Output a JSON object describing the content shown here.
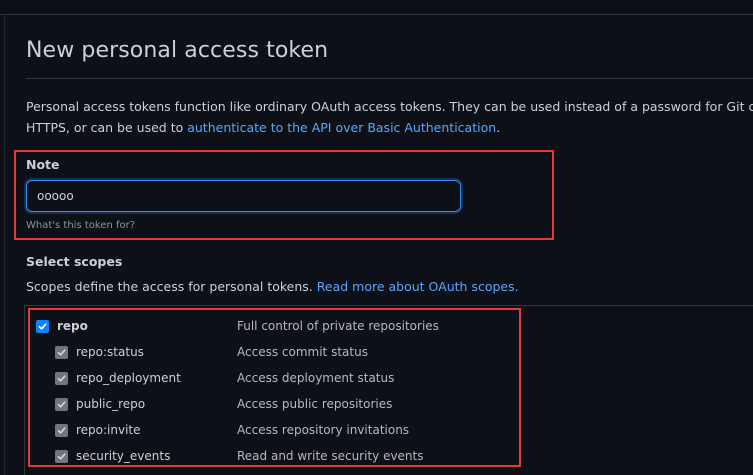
{
  "page": {
    "title": "New personal access token",
    "description_line1": "Personal access tokens function like ordinary OAuth access tokens. They can be used instead of a password for Git over",
    "description_line2_pre": "HTTPS, or can be used to ",
    "description_link": "authenticate to the API over Basic Authentication",
    "description_line2_post": "."
  },
  "note": {
    "label": "Note",
    "value": "ooooo",
    "hint": "What's this token for?"
  },
  "scopes": {
    "heading": "Select scopes",
    "description_pre": "Scopes define the access for personal tokens. ",
    "description_link": "Read more about OAuth scopes.",
    "items": [
      {
        "name": "repo",
        "description": "Full control of private repositories",
        "checked": true,
        "level": "parent"
      },
      {
        "name": "repo:status",
        "description": "Access commit status",
        "checked": true,
        "level": "child"
      },
      {
        "name": "repo_deployment",
        "description": "Access deployment status",
        "checked": true,
        "level": "child"
      },
      {
        "name": "public_repo",
        "description": "Access public repositories",
        "checked": true,
        "level": "child"
      },
      {
        "name": "repo:invite",
        "description": "Access repository invitations",
        "checked": true,
        "level": "child"
      },
      {
        "name": "security_events",
        "description": "Read and write security events",
        "checked": true,
        "level": "child"
      }
    ]
  },
  "colors": {
    "background": "#0d1117",
    "text": "#c9d1d9",
    "link": "#58a6ff",
    "highlight_box": "#e5393b",
    "checkbox_checked": "#0a84ff",
    "checkbox_inherited": "#6e7681",
    "input_focus": "#388bfd"
  },
  "icons": {
    "checkbox": "checkmark-icon"
  }
}
